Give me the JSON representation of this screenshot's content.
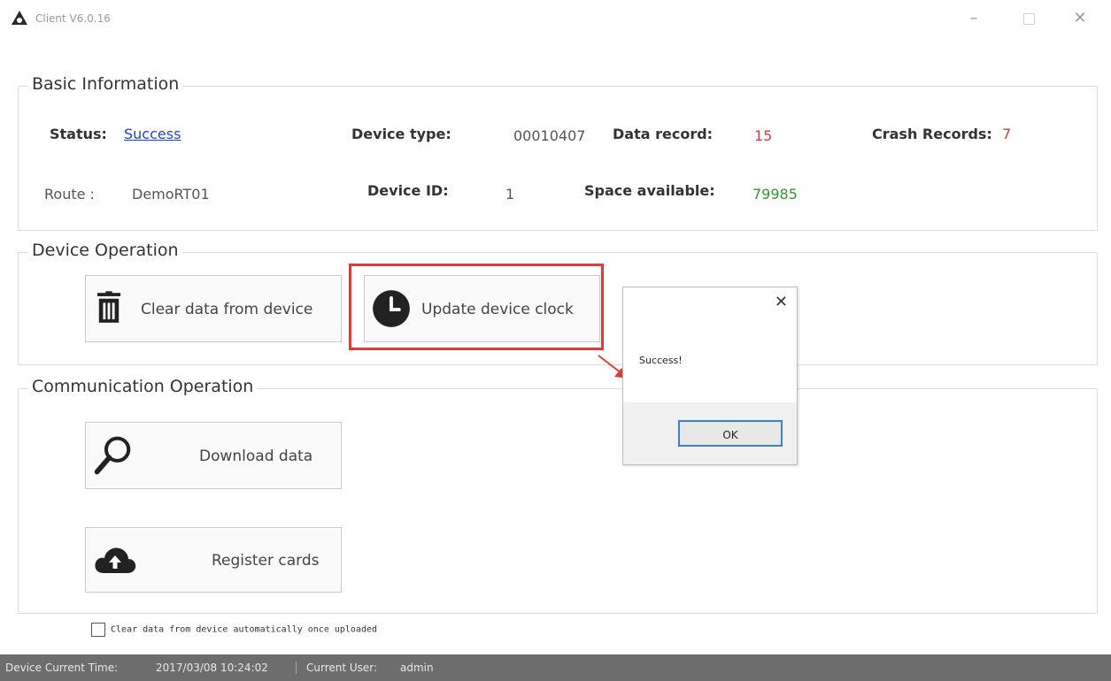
{
  "window": {
    "title": "Client V6.0.16",
    "minimize": "–",
    "close": "✕"
  },
  "basic_info": {
    "legend": "Basic Information",
    "status_label": "Status:",
    "status_value": "Success",
    "device_type_label": "Device type:",
    "device_type_value": "00010407",
    "data_record_label": "Data record:",
    "data_record_value": "15",
    "crash_records_label": "Crash Records:",
    "crash_records_value": "7",
    "route_label": "Route :",
    "route_value": "DemoRT01",
    "device_id_label": "Device ID:",
    "device_id_value": "1",
    "space_label": "Space available:",
    "space_value": "79985"
  },
  "device_op": {
    "legend": "Device Operation",
    "clear_label": "Clear data from device",
    "clear_icon": "trash-icon",
    "update_label": "Update device clock",
    "update_icon": "clock-icon"
  },
  "comm_op": {
    "legend": "Communication Operation",
    "download_label": "Download data",
    "download_icon": "search-icon",
    "register_label": "Register cards",
    "register_icon": "cloud-upload-icon"
  },
  "dialog": {
    "message": "Success!",
    "ok_label": "OK",
    "close": "✕"
  },
  "auto_clear": {
    "label": "Clear data from device automatically once uploaded",
    "checked": false
  },
  "status_bar": {
    "time_label": "Device Current Time:",
    "time_value": "2017/03/08 10:24:02",
    "user_label": "Current User:",
    "user_value": "admin"
  },
  "colors": {
    "highlight": "#e23a3a",
    "link": "#1a44d6",
    "red_value": "#e03636",
    "green_value": "#2e9b2e",
    "status_bar_bg": "#6d6d6d"
  }
}
